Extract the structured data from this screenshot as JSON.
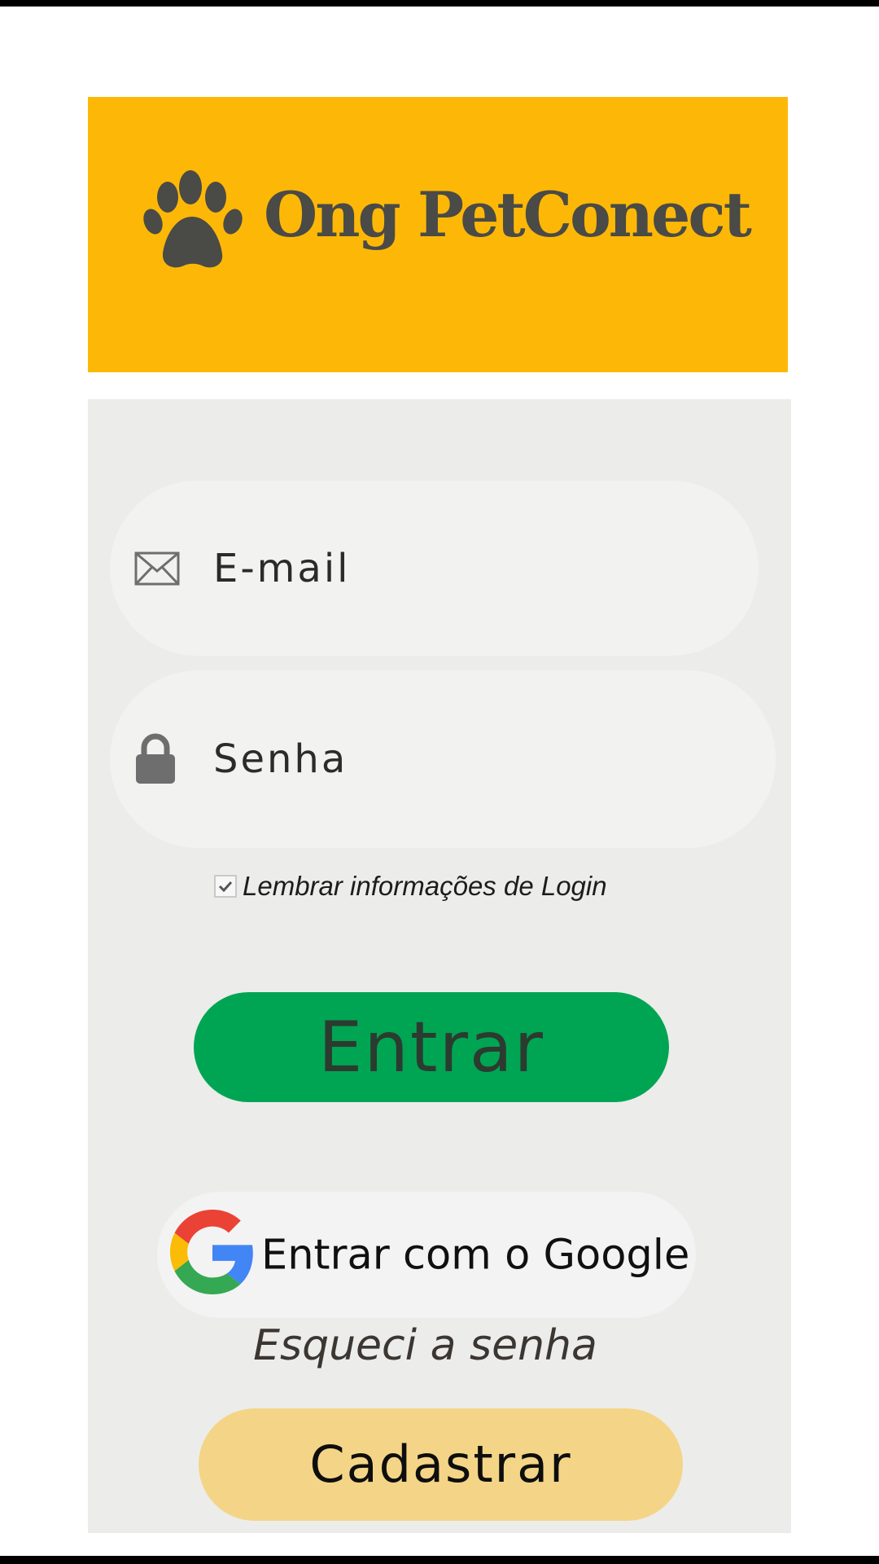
{
  "logo": {
    "brand_name": "Ong PetConect",
    "icon": "paw-icon",
    "background_color": "#fdb807"
  },
  "login_form": {
    "email_placeholder": "E-mail",
    "email_icon": "envelope-icon",
    "password_placeholder": "Senha",
    "password_icon": "lock-icon",
    "remember_label": "Lembrar informações de Login",
    "remember_checked": true
  },
  "actions": {
    "enter_label": "Entrar",
    "enter_color": "#00a553",
    "google_label": "Entrar com o Google",
    "google_icon": "google-icon",
    "forgot_label": "Esqueci a senha",
    "register_label": "Cadastrar",
    "register_color": "#f4d587"
  }
}
